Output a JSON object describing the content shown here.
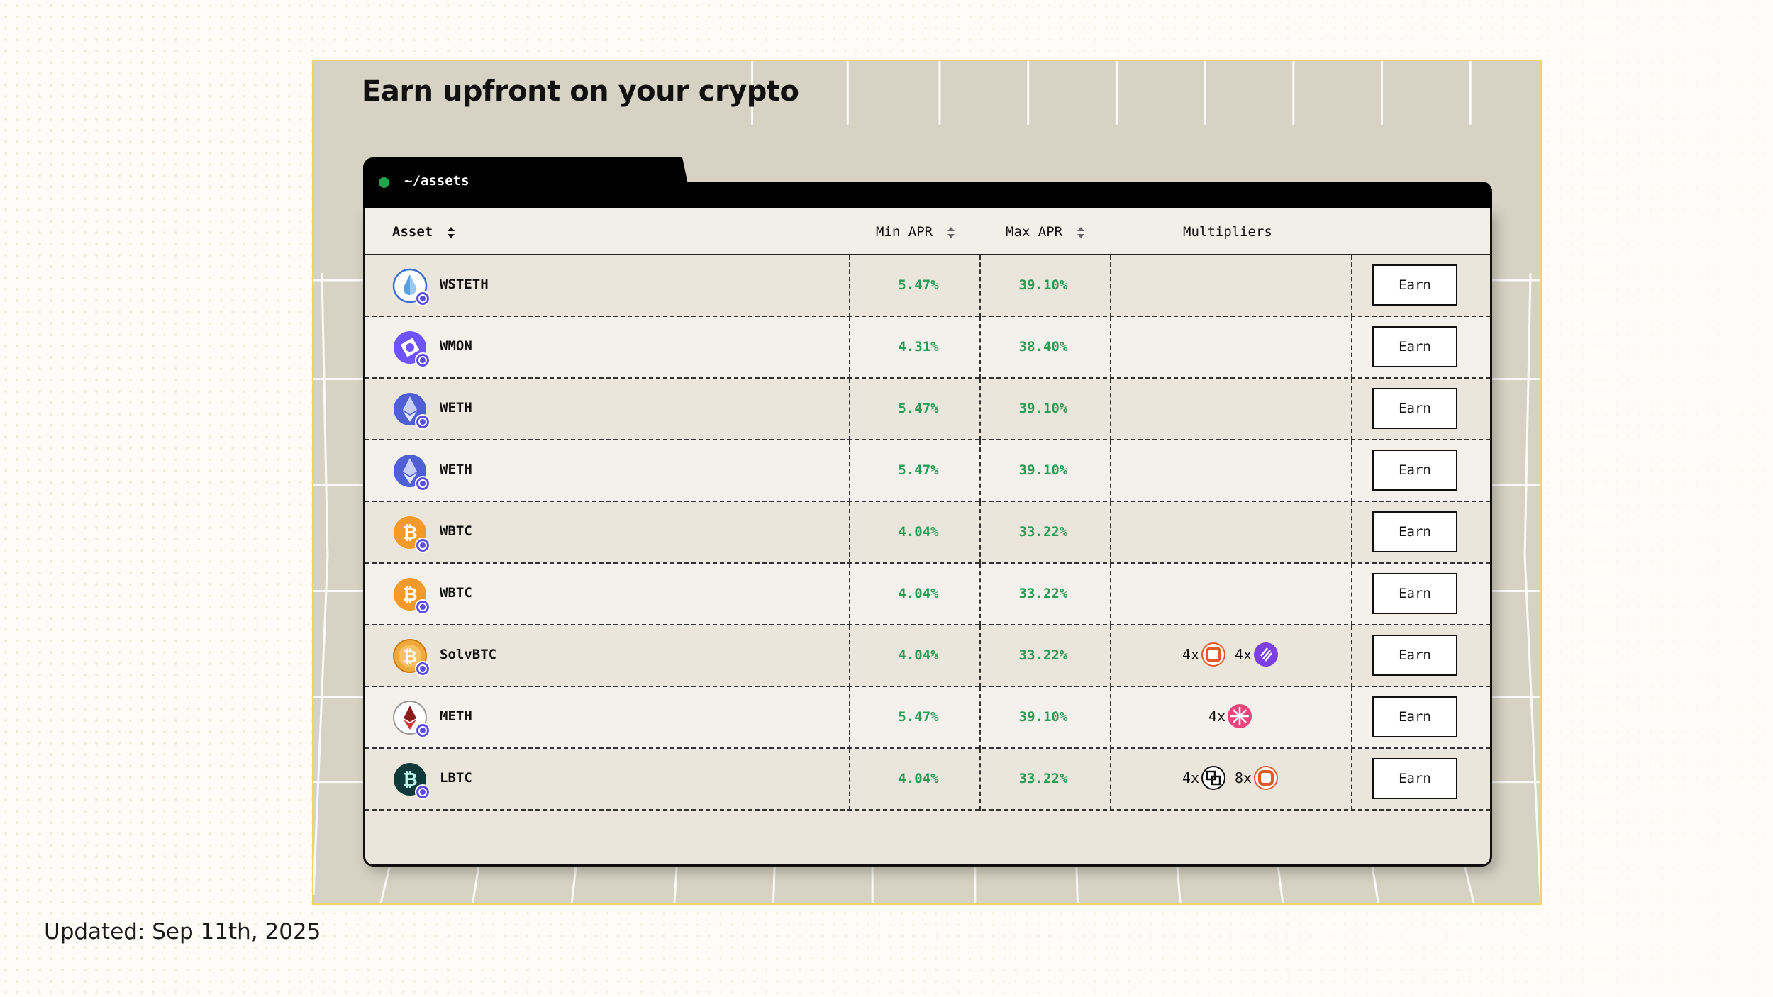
{
  "headline": "Earn upfront on your crypto",
  "window": {
    "path": "~/assets",
    "status_color": "#26a34d"
  },
  "table": {
    "headers": {
      "asset": "Asset",
      "min_apr": "Min APR",
      "max_apr": "Max APR",
      "multipliers": "Multipliers"
    },
    "rows": [
      {
        "asset": "WSTETH",
        "icon": "wsteth-coin-icon",
        "min_apr": "5.47%",
        "max_apr": "39.10%",
        "earn": "Earn",
        "multipliers": []
      },
      {
        "asset": "WMON",
        "icon": "wmon-coin-icon",
        "min_apr": "4.31%",
        "max_apr": "38.40%",
        "earn": "Earn",
        "multipliers": []
      },
      {
        "asset": "WETH",
        "icon": "weth-coin-icon",
        "min_apr": "5.47%",
        "max_apr": "39.10%",
        "earn": "Earn",
        "multipliers": []
      },
      {
        "asset": "WETH",
        "icon": "weth-coin-icon",
        "min_apr": "5.47%",
        "max_apr": "39.10%",
        "earn": "Earn",
        "multipliers": []
      },
      {
        "asset": "WBTC",
        "icon": "wbtc-coin-icon",
        "min_apr": "4.04%",
        "max_apr": "33.22%",
        "earn": "Earn",
        "multipliers": []
      },
      {
        "asset": "WBTC",
        "icon": "wbtc-coin-icon",
        "min_apr": "4.04%",
        "max_apr": "33.22%",
        "earn": "Earn",
        "multipliers": []
      },
      {
        "asset": "SolvBTC",
        "icon": "solvbtc-coin-icon",
        "min_apr": "4.04%",
        "max_apr": "33.22%",
        "earn": "Earn",
        "multipliers": [
          {
            "label": "4x",
            "icon": "orange-ring-icon"
          },
          {
            "label": "4x",
            "icon": "purple-bolt-icon"
          }
        ]
      },
      {
        "asset": "METH",
        "icon": "meth-coin-icon",
        "min_apr": "5.47%",
        "max_apr": "39.10%",
        "earn": "Earn",
        "multipliers": [
          {
            "label": "4x",
            "icon": "pink-star-icon"
          }
        ]
      },
      {
        "asset": "LBTC",
        "icon": "lbtc-coin-icon",
        "min_apr": "4.04%",
        "max_apr": "33.22%",
        "earn": "Earn",
        "multipliers": [
          {
            "label": "4x",
            "icon": "square-knot-icon"
          },
          {
            "label": "8x",
            "icon": "orange-ring-icon"
          }
        ]
      }
    ]
  },
  "footer": {
    "updated": "Updated: Sep 11th, 2025"
  },
  "colors": {
    "apr_green": "#2b9a55",
    "frame_border": "#f1d36a",
    "accent_badge": "#5b4ee6"
  }
}
